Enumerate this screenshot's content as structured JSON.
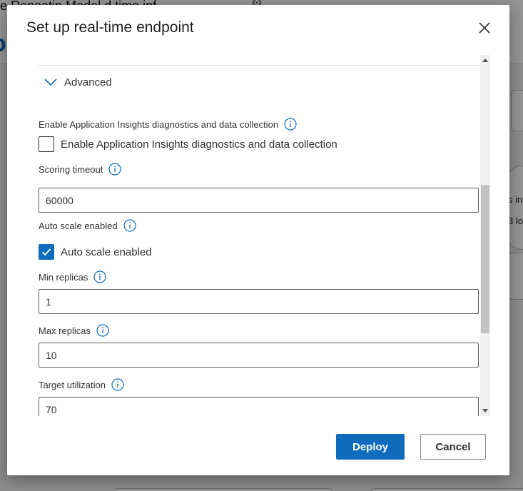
{
  "background": {
    "page_title": "e   Repeatin  Model   d time inf",
    "partial_logo": "o",
    "node_text_1": "s in",
    "node_text_2": "3 lo"
  },
  "dialog": {
    "title": "Set up real-time endpoint",
    "advanced_label": "Advanced",
    "app_insights": {
      "label": "Enable Application Insights diagnostics and data collection",
      "checkbox_label": "Enable Application Insights diagnostics and data collection",
      "checked": false
    },
    "scoring_timeout": {
      "label": "Scoring timeout",
      "value": "60000"
    },
    "auto_scale": {
      "label": "Auto scale enabled",
      "checkbox_label": "Auto scale enabled",
      "checked": true
    },
    "min_replicas": {
      "label": "Min replicas",
      "value": "1"
    },
    "max_replicas": {
      "label": "Max replicas",
      "value": "10"
    },
    "target_utilization": {
      "label": "Target utilization",
      "value": "70"
    },
    "deploy_label": "Deploy",
    "cancel_label": "Cancel"
  },
  "colors": {
    "accent": "#0f6cbd",
    "text": "#323130",
    "border": "#605e5c"
  },
  "icons": {
    "close": "close-icon",
    "chevron": "chevron-down-icon",
    "info": "info-icon",
    "check": "checkmark-icon"
  }
}
